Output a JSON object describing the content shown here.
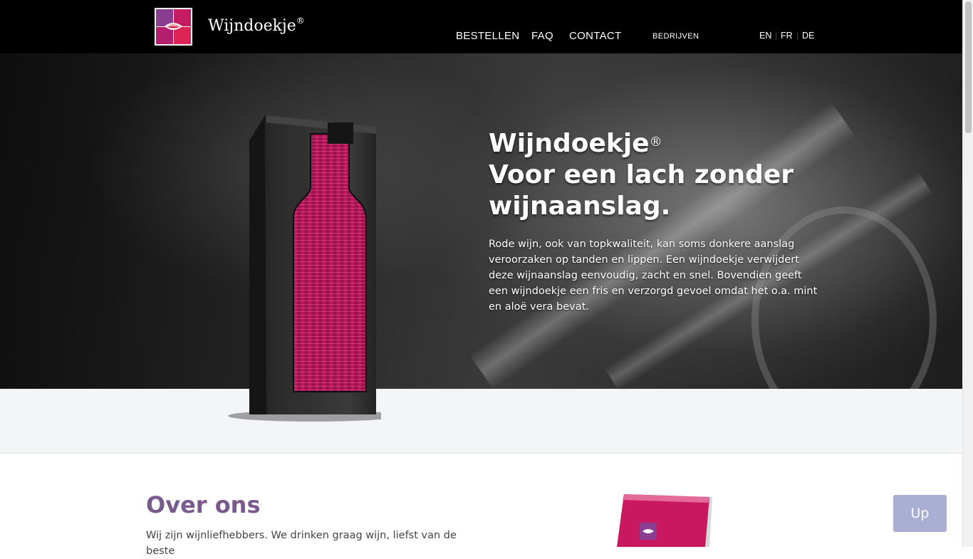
{
  "header": {
    "brand": "Wijndoekje",
    "brand_mark": "®",
    "nav": [
      "BESTELLEN",
      "FAQ",
      "CONTACT",
      "BEDRIJVEN"
    ],
    "languages": [
      "EN",
      "FR",
      "DE"
    ],
    "separators": [
      "|",
      "|"
    ]
  },
  "hero": {
    "title_brand": "Wijndoekje",
    "title_mark": "®",
    "title_line2": "Voor een lach zonder",
    "title_line3": "wijnaanslag.",
    "text": "Rode wijn, ook van topkwaliteit, kan soms donkere aanslag veroorzaken op tanden en lippen. Een wijndoekje verwijdert deze wijnaanslag eenvoudig, zacht en snel. Bovendien geeft een wijndoekje een fris en verzorgd gevoel omdat het o.a. mint en aloë vera bevat."
  },
  "about": {
    "title": "Over ons",
    "text": "Wij zijn wijnliefhebbers. We drinken graag wijn, liefst van de beste"
  },
  "up_button": "Up",
  "colors": {
    "header_bg": "#000000",
    "accent_purple": "#7a5a8c",
    "product_magenta": "#c8185f",
    "up_button_bg": "#a9aed3"
  }
}
